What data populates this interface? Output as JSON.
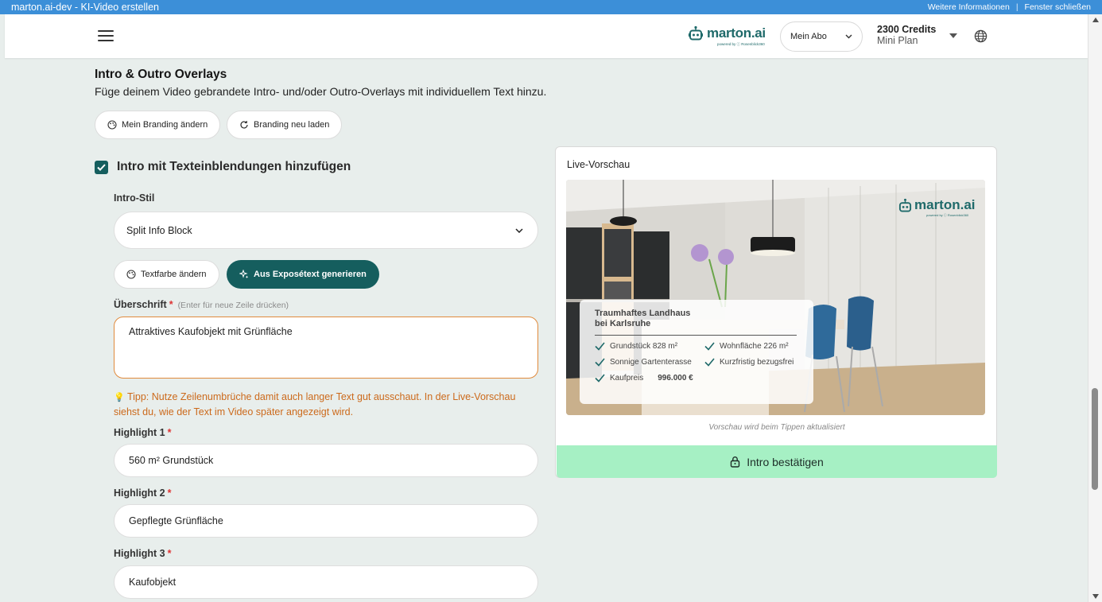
{
  "window": {
    "title": "marton.ai-dev - KI-Video erstellen",
    "link_more": "Weitere Informationen",
    "separator": "|",
    "link_close": "Fenster schließen"
  },
  "header": {
    "logo_text": "marton.ai",
    "logo_sub": "powered by ⓘ Rosenblick360",
    "abo_label": "Mein Abo",
    "credits_value": "2300 Credits",
    "plan_name": "Mini Plan"
  },
  "section": {
    "title": "Intro & Outro Overlays",
    "subtitle": "Füge deinem Video gebrandete Intro- und/oder Outro-Overlays mit individuellem Text hinzu.",
    "branding_change": "Mein Branding ändern",
    "branding_reload": "Branding neu laden"
  },
  "intro": {
    "checkbox_label": "Intro mit Texteinblendungen hinzufügen",
    "checked": true,
    "style_label": "Intro-Stil",
    "style_value": "Split Info Block",
    "text_color_btn": "Textfarbe ändern",
    "generate_btn": "Aus Exposétext generieren",
    "heading_label": "Überschrift",
    "required_mark": "*",
    "heading_hint": "(Enter für neue Zeile drücken)",
    "heading_value": "Attraktives Kaufobjekt mit Grünfläche",
    "tip_icon": "💡",
    "tip_text": "Tipp: Nutze Zeilenumbrüche damit auch langer Text gut ausschaut. In der Live-Vorschau siehst du, wie der Text im Video später angezeigt wird.",
    "highlight1_label": "Highlight 1",
    "highlight1_value": "560 m² Grundstück",
    "highlight2_label": "Highlight 2",
    "highlight2_value": "Gepflegte Grünfläche",
    "highlight3_label": "Highlight 3",
    "highlight3_value": "Kaufobjekt"
  },
  "preview": {
    "title": "Live-Vorschau",
    "overlay_title_line1": "Traumhaftes Landhaus",
    "overlay_title_line2": "bei Karlsruhe",
    "items": [
      {
        "label": "Grundstück 828 m²"
      },
      {
        "label": "Wohnfläche 226 m²"
      },
      {
        "label": "Sonnige Gartenterasse"
      },
      {
        "label": "Kurzfristig bezugsfrei"
      }
    ],
    "price_label": "Kaufpreis",
    "price_value": "996.000 €",
    "logo_text": "marton.ai",
    "logo_sub": "powered by ⓘ Rosenblick360",
    "note": "Vorschau wird beim Tippen aktualisiert",
    "confirm_btn": "Intro bestätigen"
  },
  "colors": {
    "brand": "#155e5e",
    "confirm_bg": "#a6f0c4",
    "tip": "#cc6a1c",
    "required": "#dd3333",
    "titlebar": "#3c8fd8"
  }
}
